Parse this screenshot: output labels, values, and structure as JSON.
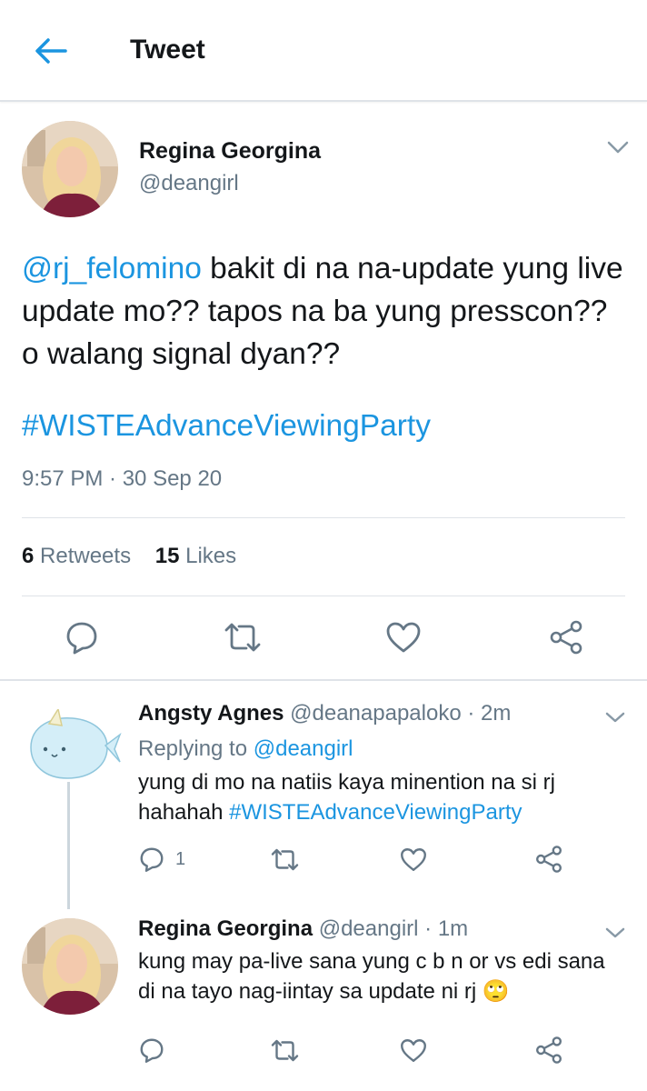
{
  "header": {
    "title": "Tweet"
  },
  "main_tweet": {
    "author_name": "Regina Georgina",
    "author_handle": "@deangirl",
    "mention": "@rj_felomino",
    "text": " bakit di na na-update yung live update mo?? tapos na ba yung presscon?? o walang signal dyan??",
    "hashtag": "#WISTEAdvanceViewingParty",
    "timestamp": "9:57 PM · 30 Sep 20",
    "retweets_count": "6",
    "retweets_label": "Retweets",
    "likes_count": "15",
    "likes_label": "Likes"
  },
  "replies": [
    {
      "author_name": "Angsty Agnes",
      "author_handle": "@deanapapaloko",
      "time": "· 2m",
      "replying_prefix": "Replying to ",
      "replying_to": "@deangirl",
      "text_line1": "yung di mo na natiis kaya minention na si rj",
      "text_line2": "hahahah ",
      "hashtag": "#WISTEAdvanceViewingParty",
      "reply_count": "1"
    },
    {
      "author_name": "Regina Georgina",
      "author_handle": "@deangirl",
      "time": "· 1m",
      "text_line1": "kung may pa-live sana yung c b n or vs edi sana",
      "text_line2": "di na tayo nag-iintay sa update ni rj",
      "emoji": "🙄"
    }
  ],
  "colors": {
    "link": "#1b95e0",
    "muted": "#657786",
    "text": "#14171a"
  },
  "icons": [
    "back-arrow-icon",
    "chevron-down-icon",
    "reply-icon",
    "retweet-icon",
    "like-icon",
    "share-icon"
  ]
}
